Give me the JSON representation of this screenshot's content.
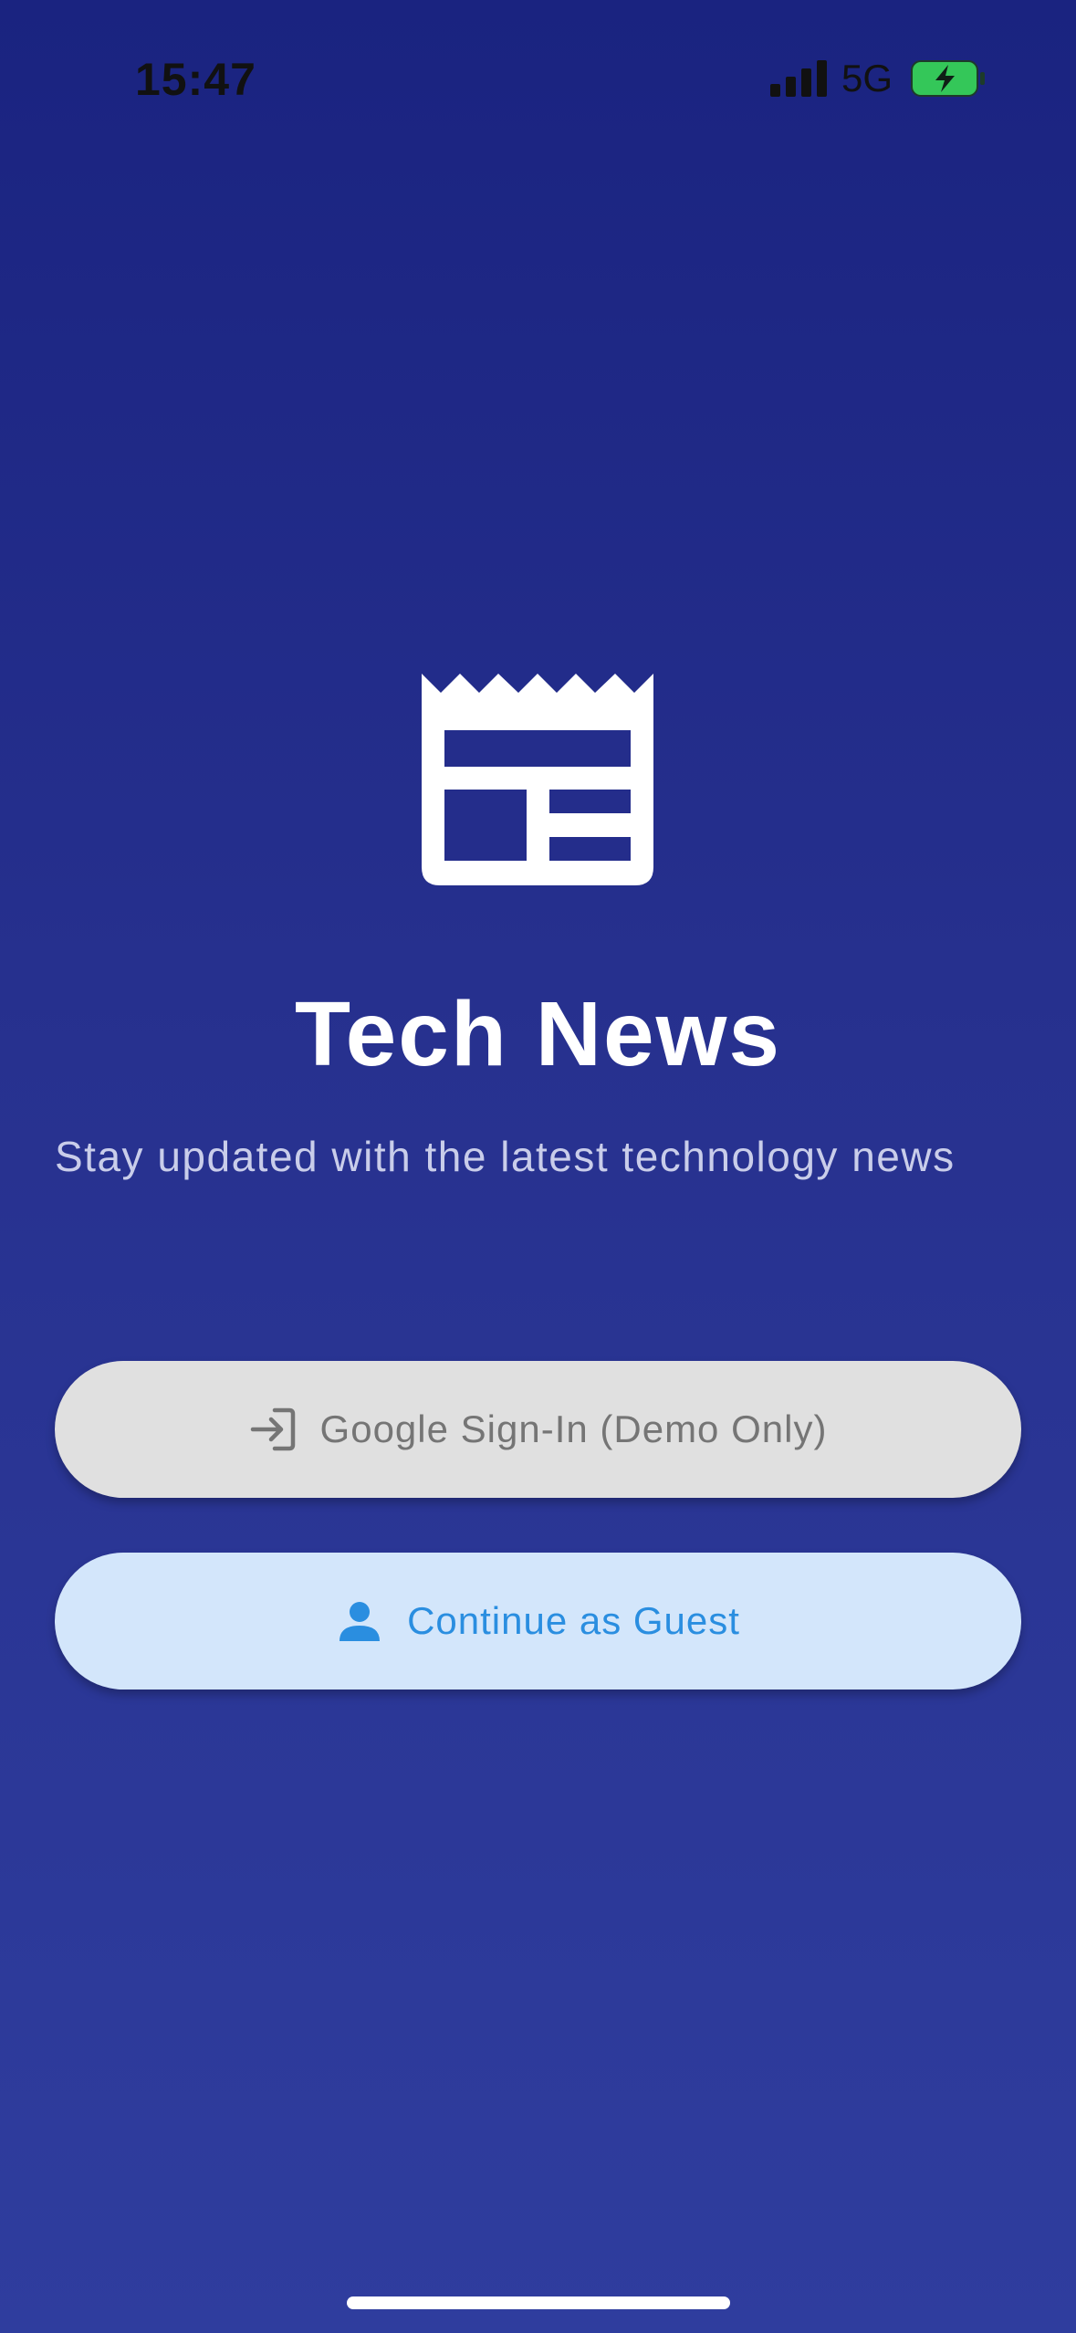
{
  "status_bar": {
    "time": "15:47",
    "network": "5G",
    "icons": [
      "signal-bars-icon",
      "battery-charging-icon"
    ],
    "battery_color": "#34c759"
  },
  "hero": {
    "icon": "newspaper-icon",
    "title": "Tech News",
    "subtitle": "Stay updated with the latest technology news"
  },
  "buttons": {
    "google_signin": {
      "icon": "login-icon",
      "label": "Google Sign-In (Demo Only)"
    },
    "guest": {
      "icon": "person-icon",
      "label": "Continue as Guest"
    }
  },
  "colors": {
    "background_top": "#1a2380",
    "background_bottom": "#2f3d9e",
    "google_button_bg": "#e0e0e0",
    "google_button_text": "#757575",
    "guest_button_bg": "#d3e6fb",
    "guest_button_text": "#2a8ee0"
  }
}
